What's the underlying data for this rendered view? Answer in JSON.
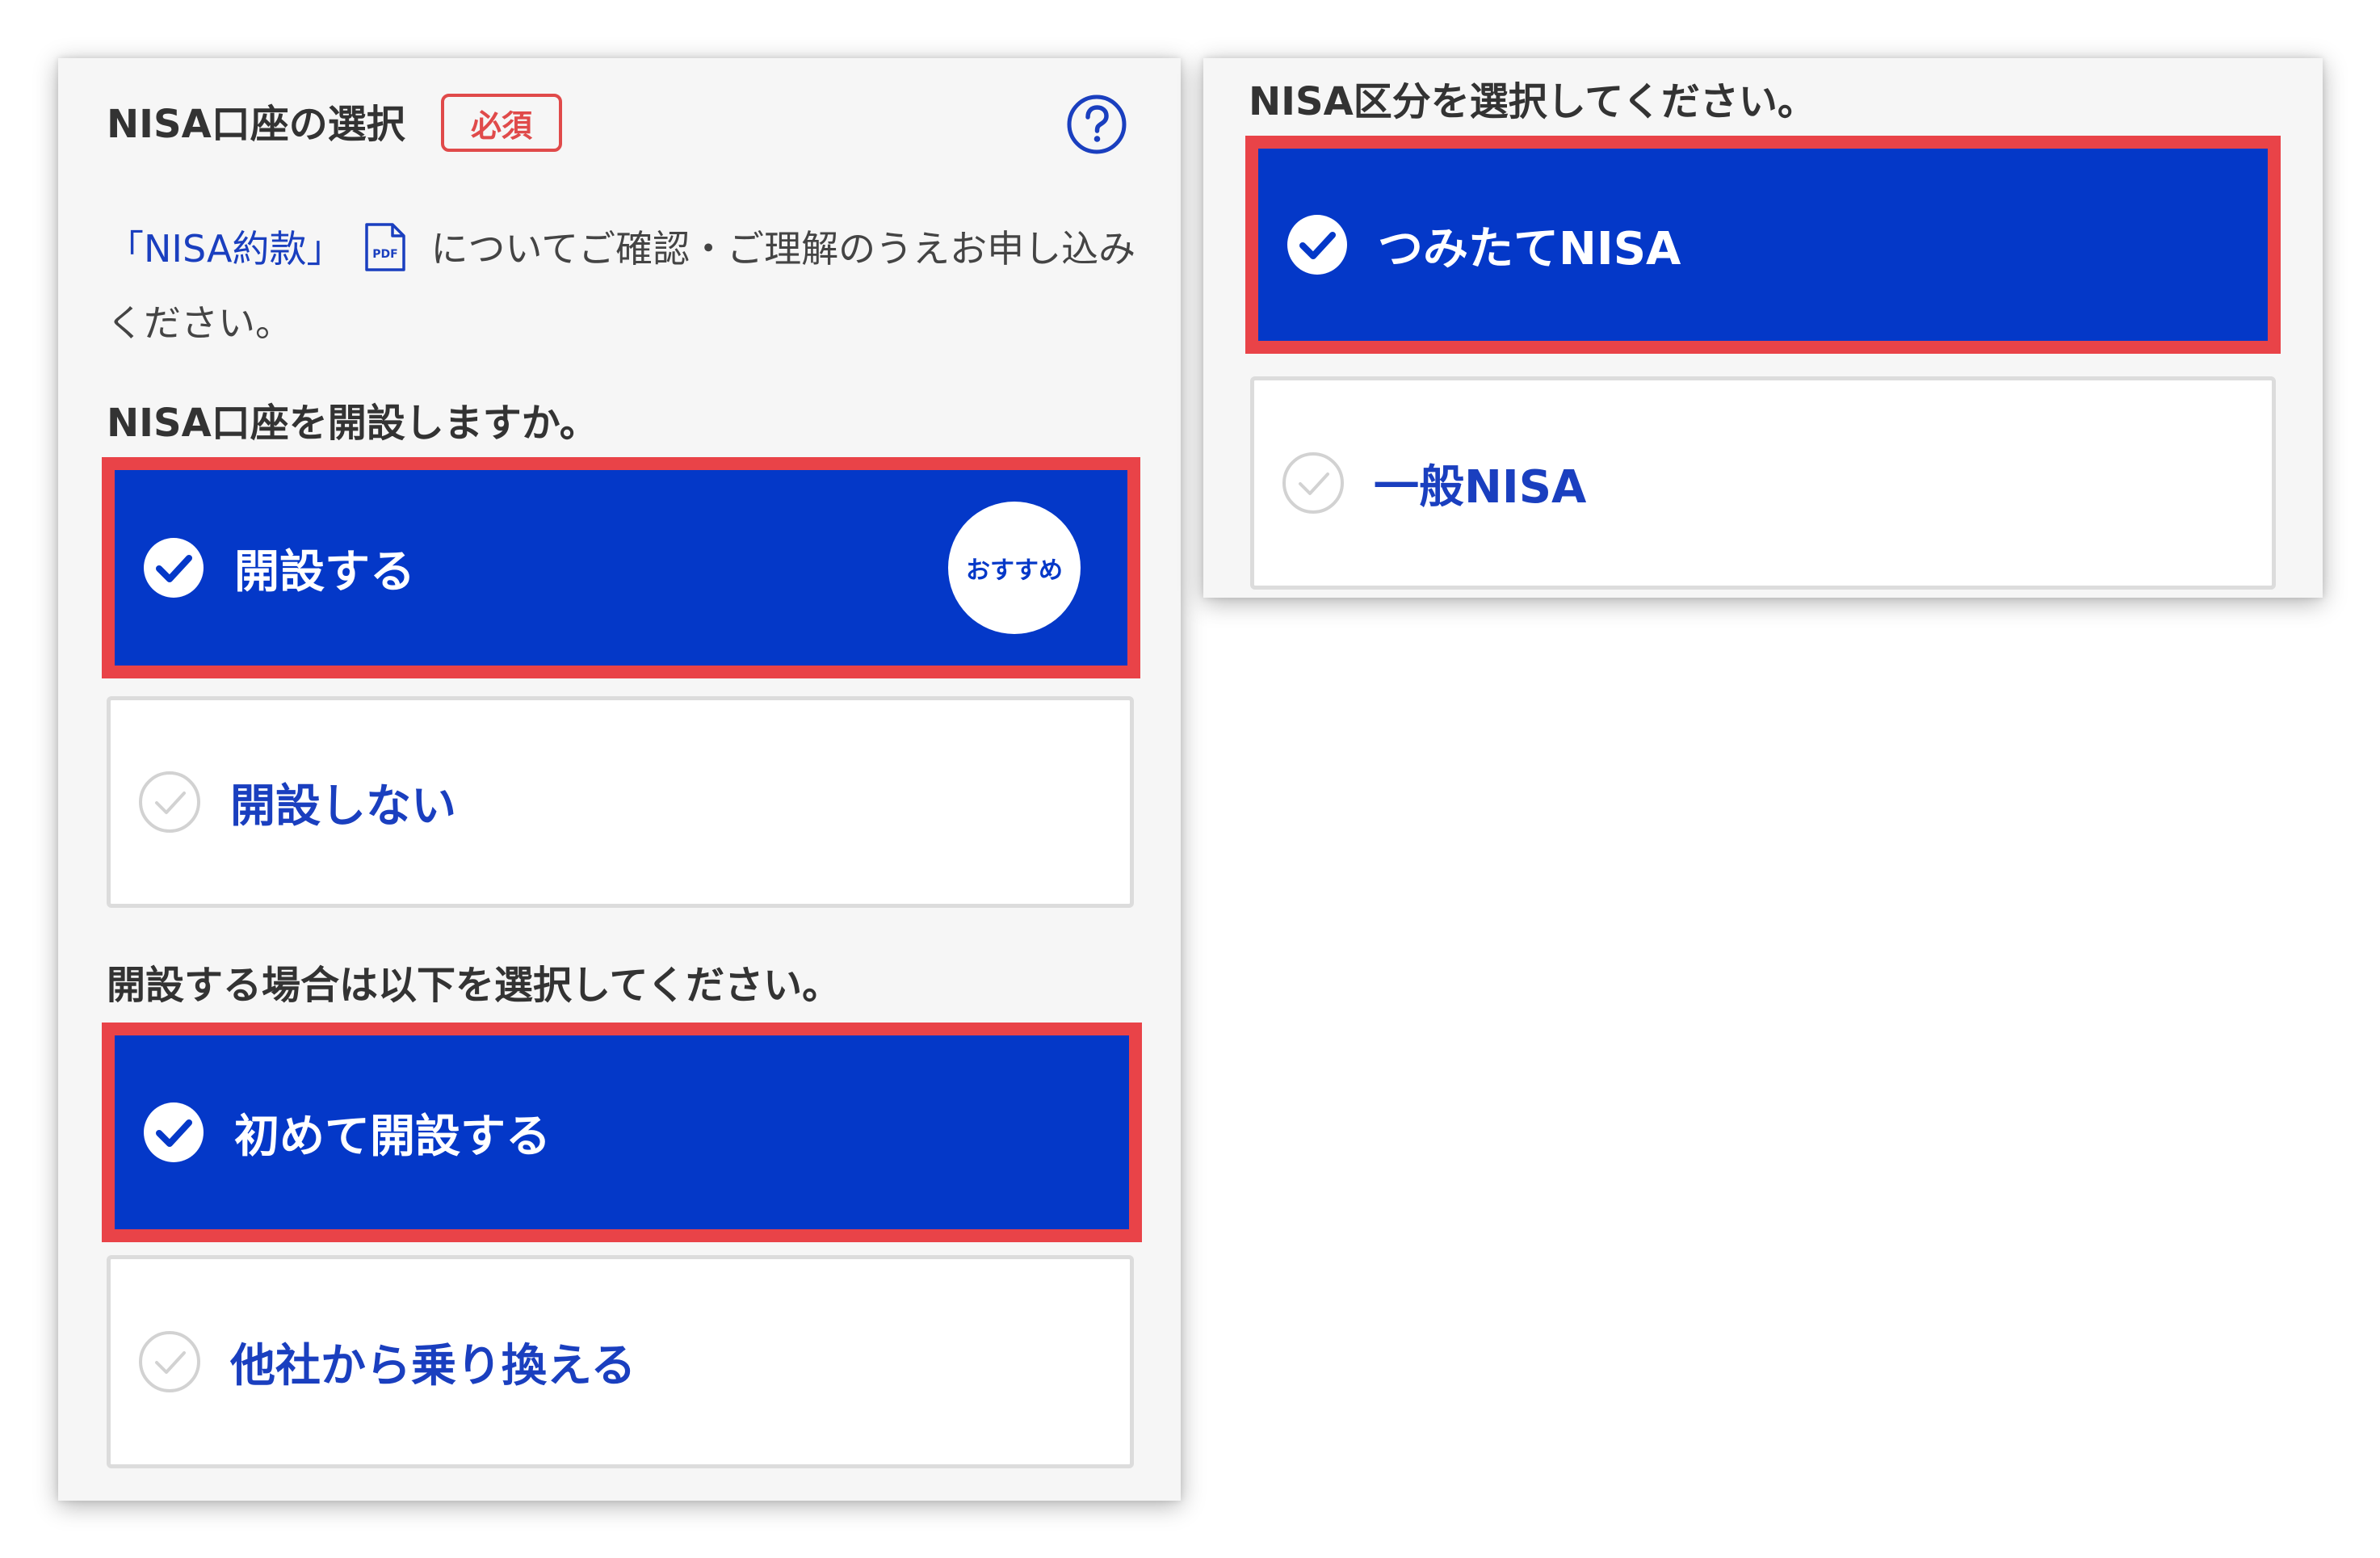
{
  "left_panel": {
    "title": "NISA口座の選択",
    "required_badge": "必須",
    "help_icon": "question-circle-icon",
    "intro": {
      "link_text": "「NISA約款」",
      "pdf_icon_label": "PDF",
      "text": "についてご確認・ご理解のうえお申し込みください。"
    },
    "open_question": "NISA口座を開設しますか。",
    "open_options": [
      {
        "label": "開設する",
        "selected": true,
        "badge": "おすすめ"
      },
      {
        "label": "開設しない",
        "selected": false
      }
    ],
    "type_question": "開設する場合は以下を選択してください。",
    "type_options": [
      {
        "label": "初めて開設する",
        "selected": true
      },
      {
        "label": "他社から乗り換える",
        "selected": false
      }
    ]
  },
  "right_panel": {
    "question": "NISA区分を選択してください。",
    "options": [
      {
        "label": "つみたてNISA",
        "selected": true
      },
      {
        "label": "一般NISA",
        "selected": false
      }
    ]
  },
  "colors": {
    "selected_bg": "#0438c8",
    "highlight_border": "#e94348",
    "link_blue": "#1a3fbf",
    "required_red": "#e04a4a",
    "panel_bg": "#f6f6f6"
  }
}
